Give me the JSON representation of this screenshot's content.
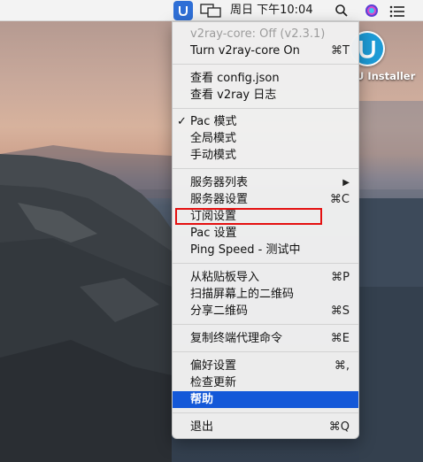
{
  "menubar": {
    "clock": "周日 下午10:04",
    "icons": [
      "v2ray-icon",
      "display-icon",
      "search-icon",
      "siri-icon",
      "notification-center-icon"
    ]
  },
  "desktop": {
    "icon_label": "U Installer"
  },
  "menu": {
    "items": [
      {
        "label": "v2ray-core: Off  (v2.3.1)",
        "shortcut": "",
        "disabled": true
      },
      {
        "label": "Turn v2ray-core On",
        "shortcut": "⌘T"
      },
      {
        "label": "查看 config.json",
        "shortcut": ""
      },
      {
        "label": "查看 v2ray 日志",
        "shortcut": ""
      },
      {
        "label": "Pac 模式",
        "shortcut": "",
        "checked": true
      },
      {
        "label": "全局模式",
        "shortcut": ""
      },
      {
        "label": "手动模式",
        "shortcut": ""
      },
      {
        "label": "服务器列表",
        "shortcut": "▶"
      },
      {
        "label": "服务器设置",
        "shortcut": "⌘C"
      },
      {
        "label": "订阅设置",
        "shortcut": ""
      },
      {
        "label": "Pac 设置",
        "shortcut": ""
      },
      {
        "label": "Ping Speed - 测试中",
        "shortcut": ""
      },
      {
        "label": "从粘贴板导入",
        "shortcut": "⌘P"
      },
      {
        "label": "扫描屏幕上的二维码",
        "shortcut": ""
      },
      {
        "label": "分享二维码",
        "shortcut": "⌘S"
      },
      {
        "label": "复制终端代理命令",
        "shortcut": "⌘E"
      },
      {
        "label": "偏好设置",
        "shortcut": "⌘,"
      },
      {
        "label": "检查更新",
        "shortcut": ""
      },
      {
        "label": "帮助",
        "shortcut": "",
        "highlighted": true
      },
      {
        "label": "退出",
        "shortcut": "⌘Q"
      }
    ],
    "check_mark": "✓"
  },
  "colors": {
    "highlight": "#1458d8",
    "annotation_box": "#e41010",
    "menubar_bg": "#f3f3f3"
  }
}
